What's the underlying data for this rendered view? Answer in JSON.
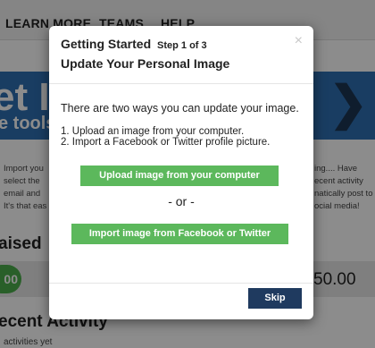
{
  "background": {
    "nav": {
      "items": [
        "LEARN MORE",
        "TEAMS",
        "HELP"
      ]
    },
    "hero": {
      "title": "et In",
      "subtitle": "e tools",
      "arrow": "❯"
    },
    "left_paragraph": [
      "Import you",
      "select the",
      "email and",
      "It's that eas"
    ],
    "right_paragraph": [
      "ing.... Have",
      "ecent activity",
      "natically post to",
      "ocial media!"
    ],
    "raised_label": "aised",
    "progress_badge": "00",
    "amount": "50.00",
    "recent_activity_heading": "ecent Activity",
    "no_activity_text": "activities yet"
  },
  "modal": {
    "title": "Getting Started",
    "step": "Step 1 of 3",
    "subtitle": "Update Your Personal Image",
    "close_icon": "×",
    "intro": "There are two ways you can update your image.",
    "options": [
      "1. Upload an image from your computer.",
      "2. Import a Facebook or Twitter profile picture."
    ],
    "upload_button": "Upload image from your computer",
    "or_text": "- or -",
    "import_button": "Import image from Facebook or Twitter",
    "skip_button": "Skip"
  },
  "colors": {
    "green_button": "#5cb85c",
    "skip_button": "#1f3a5f",
    "hero_blue": "#2f6fb2"
  }
}
